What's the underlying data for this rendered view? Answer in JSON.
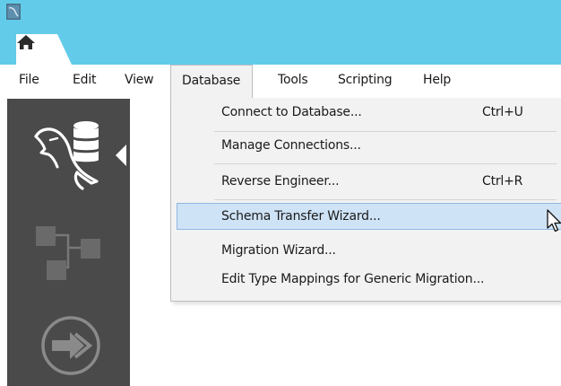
{
  "app": {
    "icon": "mysql-workbench-app-icon",
    "home_tab_icon": "home-icon"
  },
  "colors": {
    "accent": "#62cbe9",
    "sidebar": "#4a4a4a",
    "menu_bg": "#f2f2f2",
    "highlight": "#cfe3f6"
  },
  "menubar": {
    "items": [
      {
        "label": "File"
      },
      {
        "label": "Edit"
      },
      {
        "label": "View"
      },
      {
        "label": "Database"
      },
      {
        "label": "Tools"
      },
      {
        "label": "Scripting"
      },
      {
        "label": "Help"
      }
    ],
    "open_menu": "Database"
  },
  "sidebar": {
    "items": [
      {
        "icon": "mysql-connections-icon"
      },
      {
        "icon": "models-icon"
      },
      {
        "icon": "migration-icon"
      }
    ]
  },
  "database_menu": {
    "items": [
      {
        "label": "Connect to Database...",
        "shortcut": "Ctrl+U"
      },
      {
        "label": "Manage Connections..."
      },
      {
        "label": "Reverse Engineer...",
        "shortcut": "Ctrl+R"
      },
      {
        "label": "Schema Transfer Wizard...",
        "highlighted": true
      },
      {
        "label": "Migration Wizard..."
      },
      {
        "label": "Edit Type Mappings for Generic Migration..."
      }
    ]
  }
}
